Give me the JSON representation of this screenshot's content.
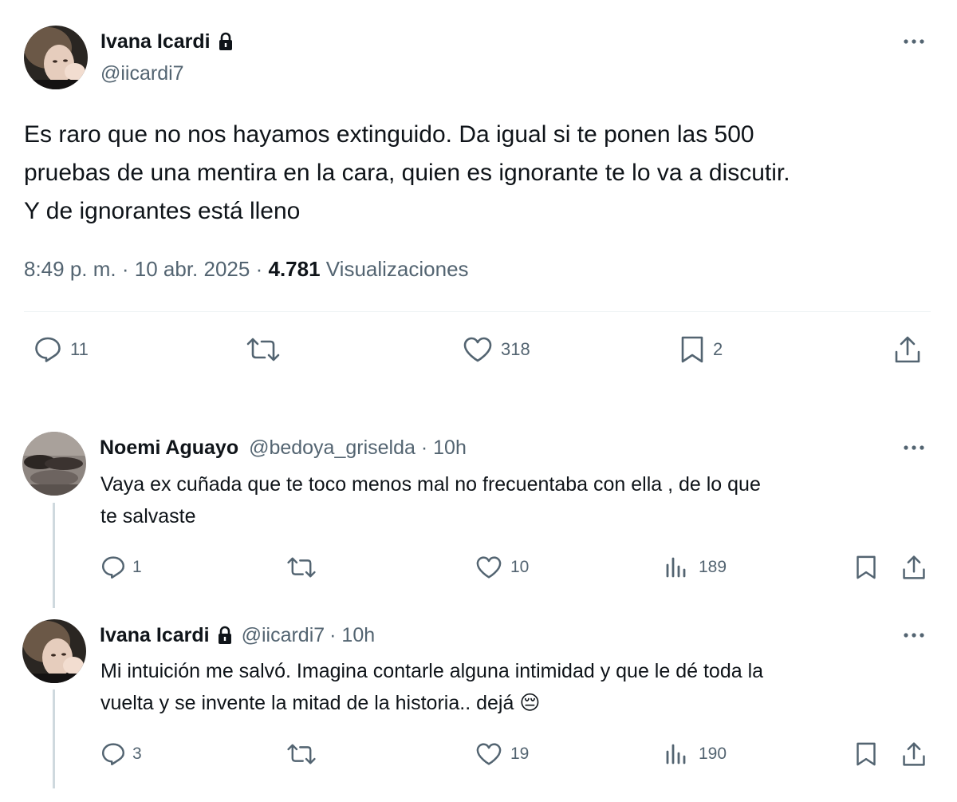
{
  "main_tweet": {
    "author_name": "Ivana Icardi",
    "handle": "@iicardi7",
    "text_lines": [
      "Es raro que no nos hayamos extinguido. Da igual si te ponen las 500",
      "pruebas de una mentira en la cara, quien es ignorante te lo va a discutir.",
      "Y de ignorantes está lleno"
    ],
    "time": "8:49 p. m.",
    "separator": "·",
    "date": "10 abr. 2025",
    "views_count": "4.781",
    "views_label": "Visualizaciones",
    "replies": "11",
    "likes": "318",
    "bookmarks": "2"
  },
  "replies": [
    {
      "author_name": "Noemi Aguayo",
      "handle": "@bedoya_griselda",
      "time": "· 10h",
      "text_lines": [
        "Vaya ex cuñada que te toco menos mal no frecuentaba con ella , de lo que",
        "te salvaste"
      ],
      "replies": "1",
      "likes": "10",
      "views": "189"
    },
    {
      "author_name": "Ivana Icardi",
      "handle": "@iicardi7",
      "time": "· 10h",
      "text_lines": [
        "Mi intuición me salvó. Imagina contarle alguna intimidad y que le dé toda la",
        "vuelta y se invente la mitad de la historia.. dejá"
      ],
      "emoji": "😔",
      "replies": "3",
      "likes": "19",
      "views": "190"
    }
  ],
  "icons": {
    "lock": "lock-icon",
    "more": "more-icon",
    "reply": "reply-icon",
    "retweet": "retweet-icon",
    "like": "like-icon",
    "bookmark": "bookmark-icon",
    "share": "share-icon",
    "views": "views-icon"
  },
  "colors": {
    "text": "#0f1419",
    "secondary": "#536471",
    "divider": "#eff3f4",
    "thread_line": "#cfd9de"
  }
}
